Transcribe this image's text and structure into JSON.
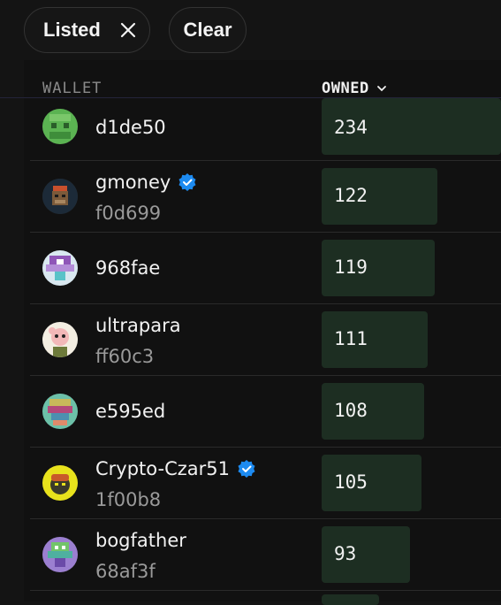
{
  "filters": {
    "listed_label": "Listed",
    "clear_label": "Clear"
  },
  "table": {
    "columns": {
      "wallet": "WALLET",
      "owned": "OWNED"
    },
    "max_owned": 234,
    "rows": [
      {
        "name": "d1de50",
        "address": "",
        "verified": false,
        "owned": "234",
        "avatar": "green-pixel-avatar"
      },
      {
        "name": "gmoney",
        "address": "f0d699",
        "verified": true,
        "owned": "122",
        "avatar": "ape-avatar"
      },
      {
        "name": "968fae",
        "address": "",
        "verified": false,
        "owned": "119",
        "avatar": "purple-pixel-avatar"
      },
      {
        "name": "ultrapara",
        "address": "ff60c3",
        "verified": false,
        "owned": "111",
        "avatar": "cartoon-avatar"
      },
      {
        "name": "e595ed",
        "address": "",
        "verified": false,
        "owned": "108",
        "avatar": "teal-pixel-avatar"
      },
      {
        "name": "Crypto-Czar51",
        "address": "1f00b8",
        "verified": true,
        "owned": "105",
        "avatar": "yellow-character-avatar"
      },
      {
        "name": "bogfather",
        "address": "68af3f",
        "verified": false,
        "owned": "93",
        "avatar": "purple-green-pixel-avatar"
      }
    ]
  },
  "colors": {
    "background": "#141414",
    "bar": "#1d2e22",
    "verified_badge": "#1d8bf1"
  }
}
